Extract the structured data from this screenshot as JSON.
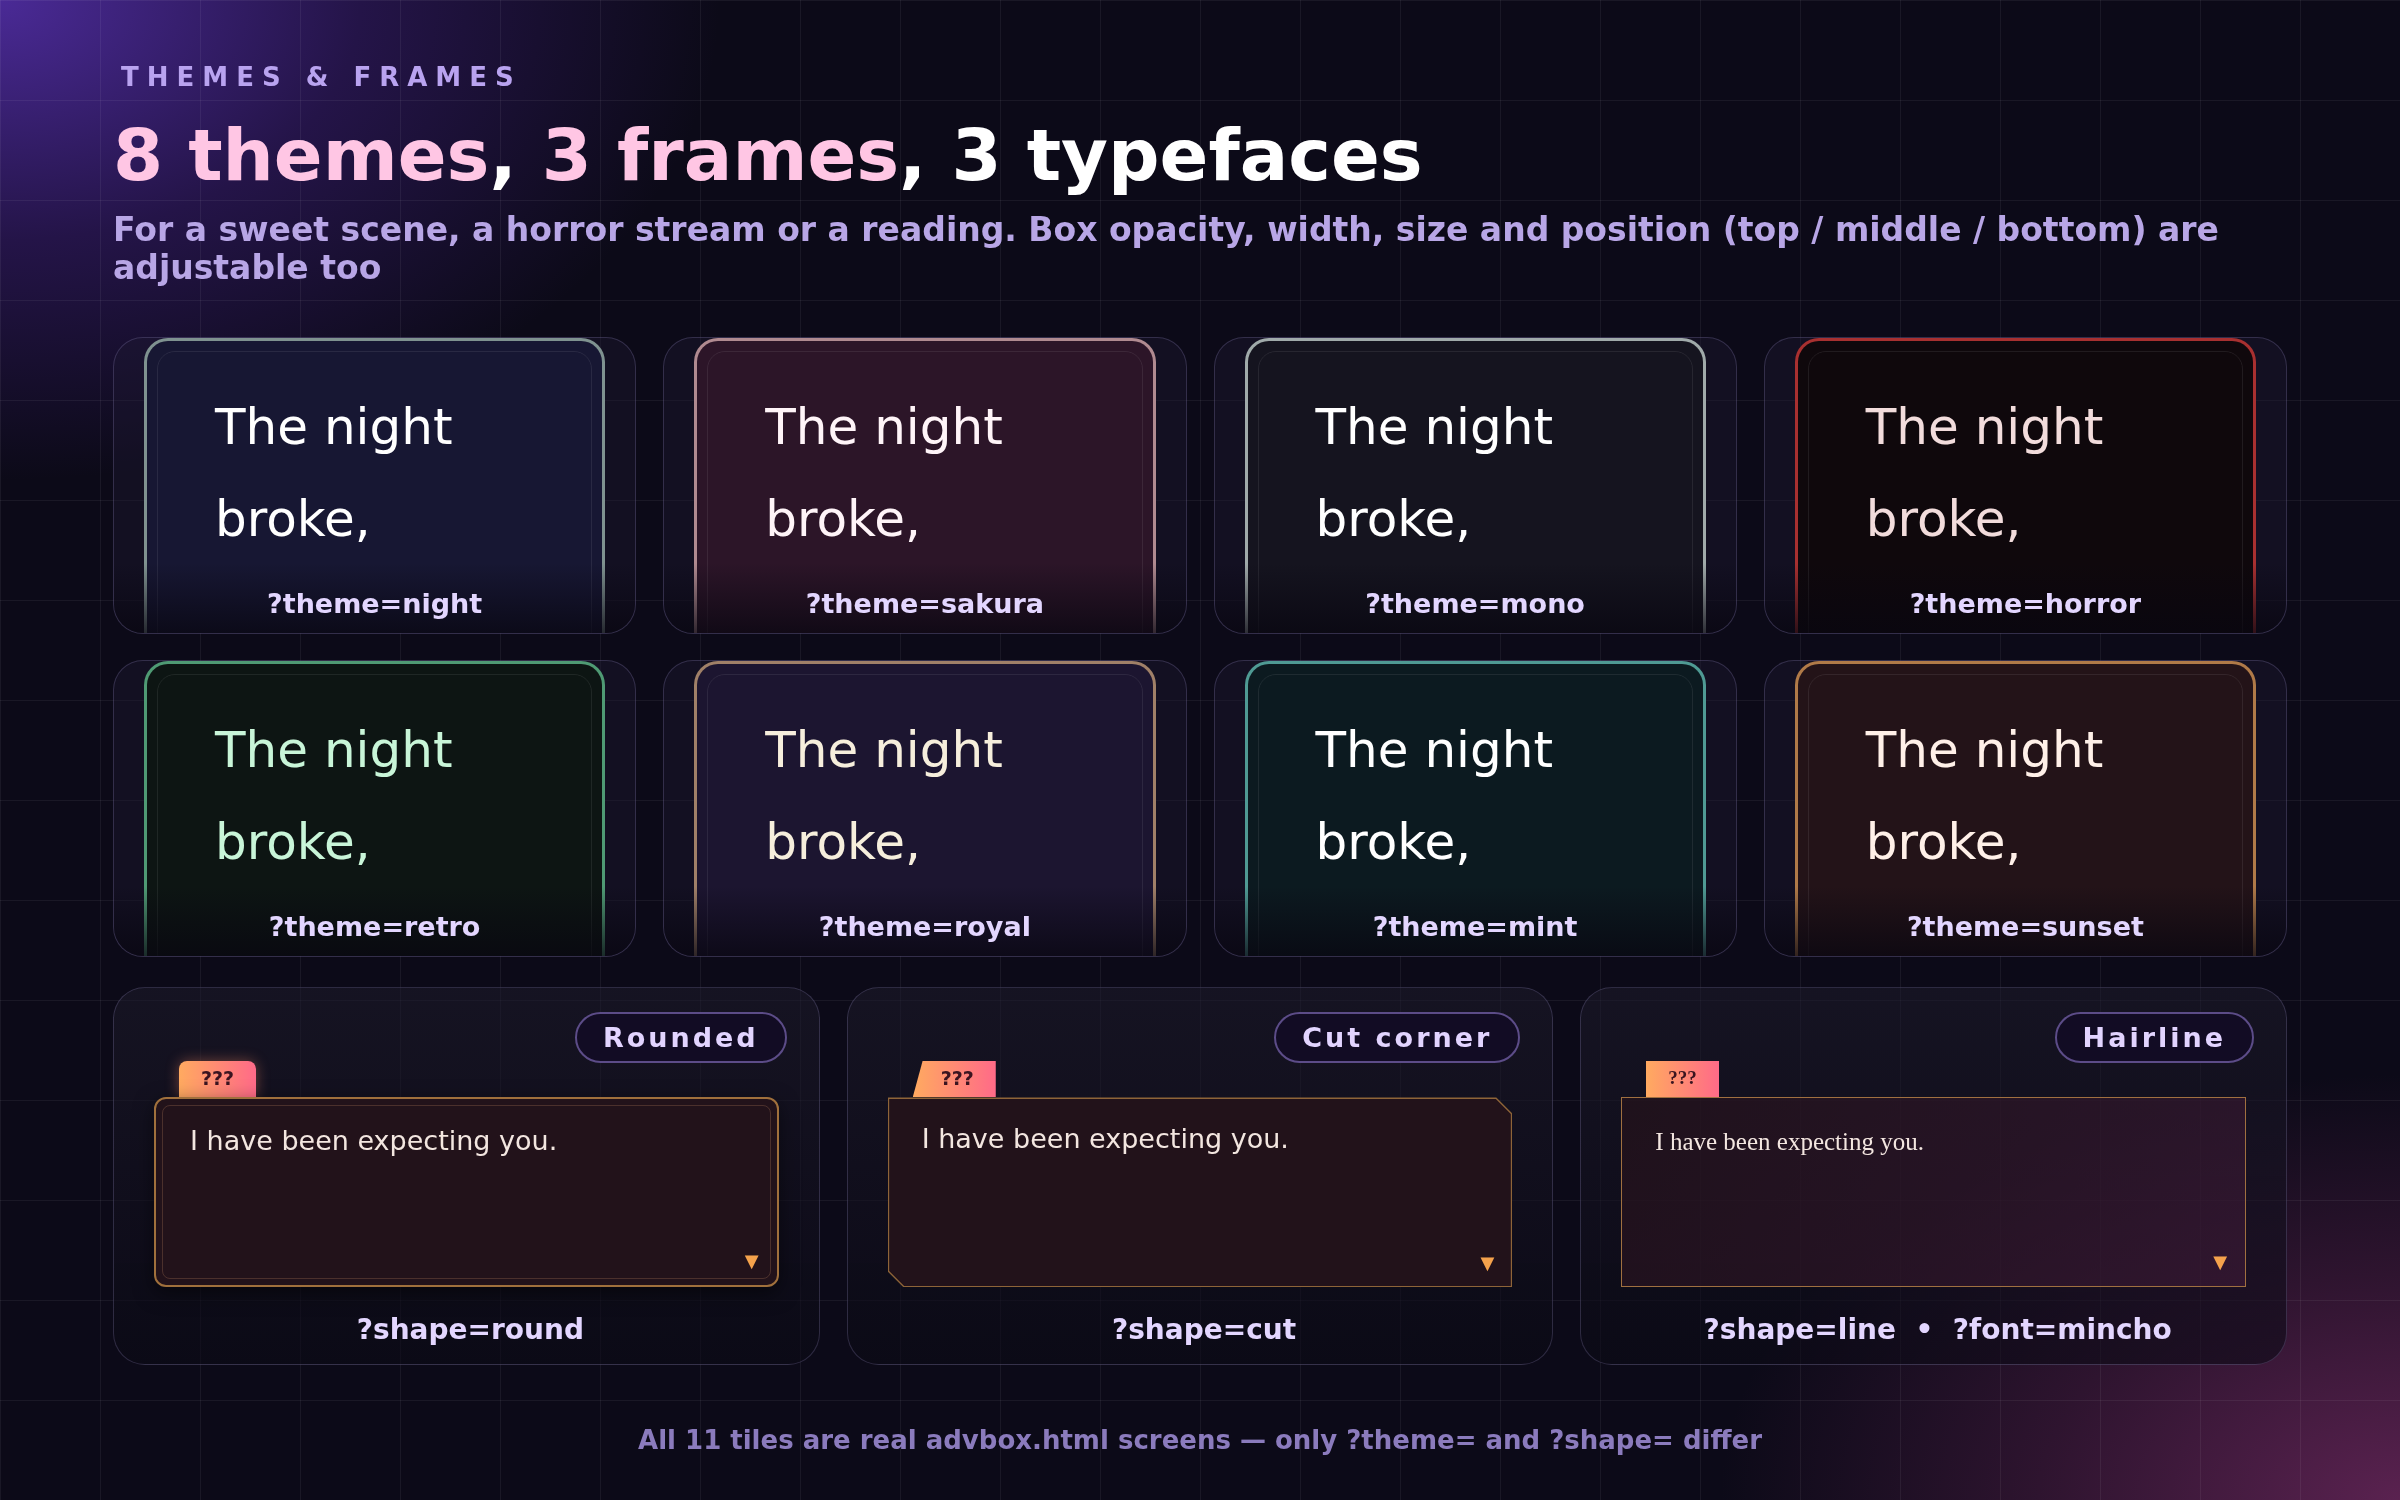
{
  "eyebrow": "THEMES & FRAMES",
  "title": [
    {
      "text": "8 themes",
      "accent": true
    },
    {
      "text": ", ",
      "accent": false
    },
    {
      "text": "3 frames",
      "accent": true
    },
    {
      "text": ", 3 typefaces",
      "accent": false
    }
  ],
  "subtitle": "For a sweet scene, a horror stream or a reading. Box opacity, width, size and position (top / middle / bottom) are adjustable too",
  "themes": [
    {
      "kind": "night",
      "text": "The night broke,",
      "caption": "?theme=night"
    },
    {
      "kind": "sakura",
      "text": "The night broke,",
      "caption": "?theme=sakura"
    },
    {
      "kind": "mono",
      "text": "The night broke,",
      "caption": "?theme=mono"
    },
    {
      "kind": "horror",
      "text": "The night broke,",
      "caption": "?theme=horror"
    },
    {
      "kind": "retro",
      "text": "The night broke,",
      "caption": "?theme=retro"
    },
    {
      "kind": "royal",
      "text": "The night broke,",
      "caption": "?theme=royal"
    },
    {
      "kind": "mint",
      "text": "The night broke,",
      "caption": "?theme=mint"
    },
    {
      "kind": "sunset",
      "text": "The night broke,",
      "caption": "?theme=sunset"
    }
  ],
  "frames": [
    {
      "kind": "round",
      "serif": false,
      "chip": "Rounded",
      "name": "???",
      "text": "I have been expecting you.",
      "arrow": "▼",
      "caption": "?shape=round"
    },
    {
      "kind": "cut",
      "serif": false,
      "chip": "Cut corner",
      "name": "???",
      "text": "I have been expecting you.",
      "arrow": "▼",
      "caption": "?shape=cut"
    },
    {
      "kind": "line",
      "serif": true,
      "chip": "Hairline",
      "name": "???",
      "text": "I have been expecting you.",
      "arrow": "▼",
      "caption": "?shape=line  •  ?font=mincho"
    }
  ],
  "footer": "All 11 tiles are real advbox.html screens — only ?theme= and ?shape= differ"
}
